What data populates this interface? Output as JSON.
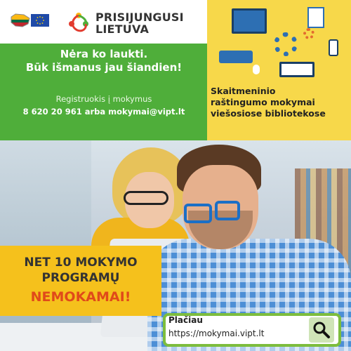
{
  "brand": {
    "line1": "PRISIJUNGUSI",
    "line2": "LIETUVA"
  },
  "hero": {
    "headline_line1": "Nėra ko laukti.",
    "headline_line2": "Būk išmanus jau šiandien!",
    "register_text": "Registruokis į mokymus",
    "contact": "8 620 20 961 arba mokymai@vipt.lt"
  },
  "subtitle": {
    "line1": "Skaitmeninio",
    "line2": "raštingumo mokymai",
    "line3": "viešosiose bibliotekose"
  },
  "promo": {
    "line1": "NET 10  MOKYMO",
    "line2": "PROGRAMŲ",
    "line3": "NEMOKAMAI!"
  },
  "info": {
    "label": "Plačiau",
    "url": "https://mokymai.vipt.lt"
  },
  "icons": {
    "flag_lt": "lithuania-map-flag-icon",
    "flag_eu": "eu-flag-icon",
    "brand_logo": "prisijungusi-lietuva-logo-icon",
    "search": "search-icon"
  },
  "colors": {
    "green": "#4fae3a",
    "yellow": "#f7d84a",
    "promo_yellow": "#f5c11c",
    "promo_red": "#e04a1a",
    "blue": "#2d6fb3"
  }
}
